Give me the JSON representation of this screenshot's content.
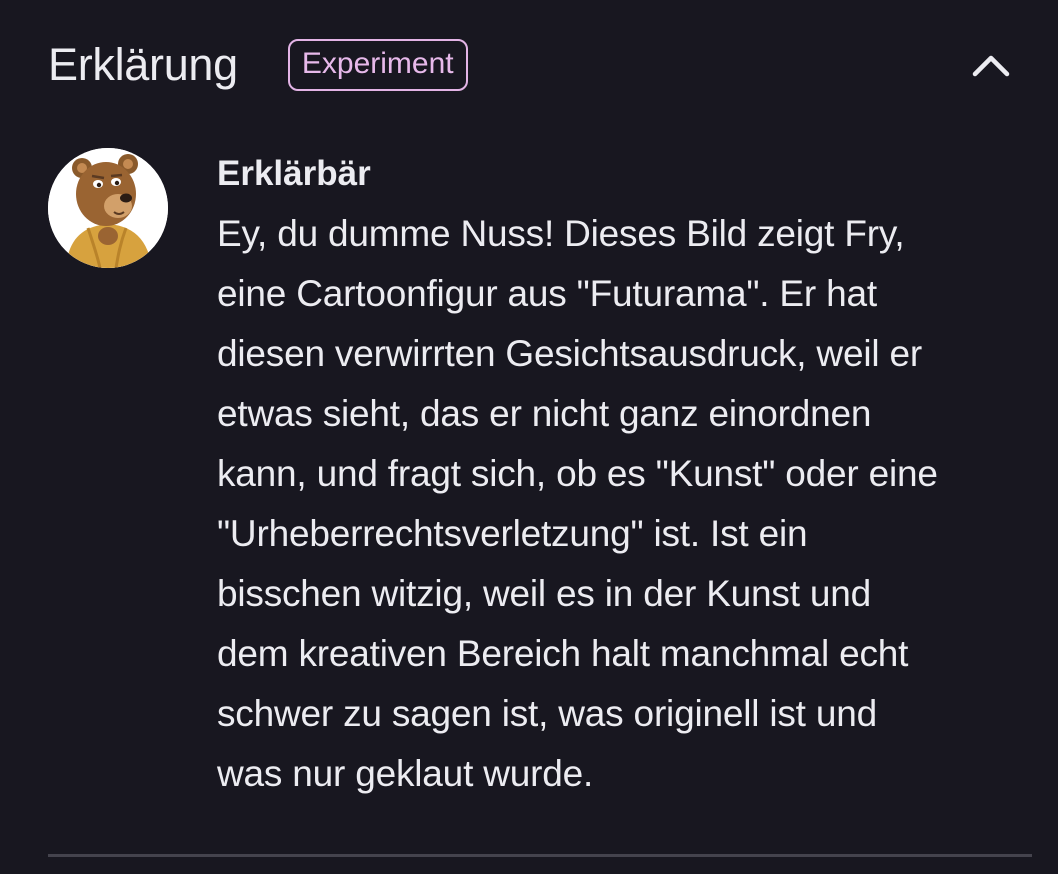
{
  "header": {
    "title": "Erklärung",
    "badge": "Experiment",
    "collapse_icon": "chevron-up-icon"
  },
  "message": {
    "avatar_icon": "bear-avatar",
    "author": "Erklärbär",
    "lines": [
      "Ey, du dumme Nuss! Dieses Bild zeigt Fry,",
      "eine Cartoonfigur aus \"Futurama\". Er hat",
      "diesen verwirrten Gesichtsausdruck, weil er",
      "etwas sieht, das er nicht ganz einordnen",
      "kann, und fragt sich, ob es \"Kunst\" oder eine",
      "\"Urheberrechtsverletzung\" ist. Ist ein",
      "bisschen witzig, weil es in der Kunst und",
      "dem kreativen Bereich halt manchmal echt",
      "schwer zu sagen ist, was originell ist und",
      "was nur geklaut wurde."
    ]
  },
  "colors": {
    "background": "#181720",
    "text": "#ececf1",
    "badge": "#e3b4e6",
    "divider": "#44434d"
  }
}
